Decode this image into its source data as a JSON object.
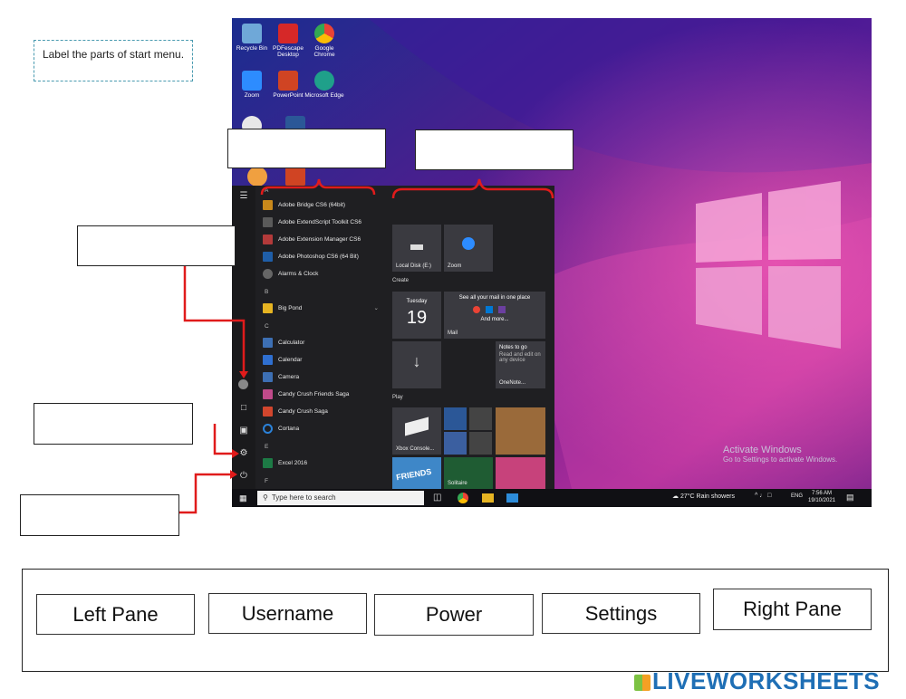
{
  "instruction": "Label the parts of start menu.",
  "desktop_icons": [
    {
      "label": "Recycle Bin",
      "icon": "recycle-bin-icon",
      "color": "#6fa8d8"
    },
    {
      "label": "PDFescape Desktop",
      "icon": "pdf-icon",
      "color": "#d62828"
    },
    {
      "label": "Google Chrome",
      "icon": "chrome-icon",
      "color": "#34a853"
    },
    {
      "label": "Zoom",
      "icon": "zoom-icon",
      "color": "#2d8cff"
    },
    {
      "label": "PowerPoint",
      "icon": "powerpoint-icon",
      "color": "#d04423"
    },
    {
      "label": "Microsoft Edge",
      "icon": "edge-icon",
      "color": "#1fa08a"
    }
  ],
  "app_list": {
    "letter_a": "A",
    "letter_b": "B",
    "letter_c": "C",
    "letter_e": "E",
    "letter_f": "F",
    "items": [
      {
        "label": "Adobe Bridge CS6 (64bit)",
        "color": "#c9891b"
      },
      {
        "label": "Adobe ExtendScript Toolkit CS6",
        "color": "#5a5a5a"
      },
      {
        "label": "Adobe Extension Manager CS6",
        "color": "#b33a3a"
      },
      {
        "label": "Adobe Photoshop CS6 (64 Bit)",
        "color": "#1f5ea8"
      },
      {
        "label": "Alarms & Clock",
        "color": "#666666"
      },
      {
        "label": "Big Pond",
        "color": "#e6b422"
      },
      {
        "label": "Calculator",
        "color": "#3d6fb3"
      },
      {
        "label": "Calendar",
        "color": "#2f6fd0"
      },
      {
        "label": "Camera",
        "color": "#3d6fb3"
      },
      {
        "label": "Candy Crush Friends Saga",
        "color": "#c04a8a"
      },
      {
        "label": "Candy Crush Saga",
        "color": "#d2462d"
      },
      {
        "label": "Cortana",
        "color": "#2b82d9"
      },
      {
        "label": "Excel 2016",
        "color": "#1d7a45"
      }
    ]
  },
  "tiles": {
    "local_disk": "Local Disk (E:)",
    "zoom": "Zoom",
    "create": "Create",
    "day_name": "Tuesday",
    "day_num": "19",
    "mail_header": "See all your mail in one place",
    "mail_more": "And more...",
    "mail": "Mail",
    "notes_title": "Notes to go",
    "notes_sub": "Read and edit on any device",
    "onenote": "OneNote...",
    "play": "Play",
    "xbox": "Xbox Console...",
    "solitaire": "Solitaire",
    "friends": "FRIENDS"
  },
  "taskbar": {
    "search_placeholder": "Type here to search",
    "weather": "27°C  Rain showers",
    "lang": "ENG",
    "time": "7:56 AM",
    "date": "19/10/2021"
  },
  "watermark": {
    "title": "Activate Windows",
    "sub": "Go to Settings to activate Windows."
  },
  "answers": [
    "Left Pane",
    "Username",
    "Power",
    "Settings",
    "Right Pane"
  ],
  "brand": "LIVEWORKSHEETS",
  "colors": {
    "annotation_red": "#e01b1b",
    "brand_blue": "#1f6fb5"
  }
}
